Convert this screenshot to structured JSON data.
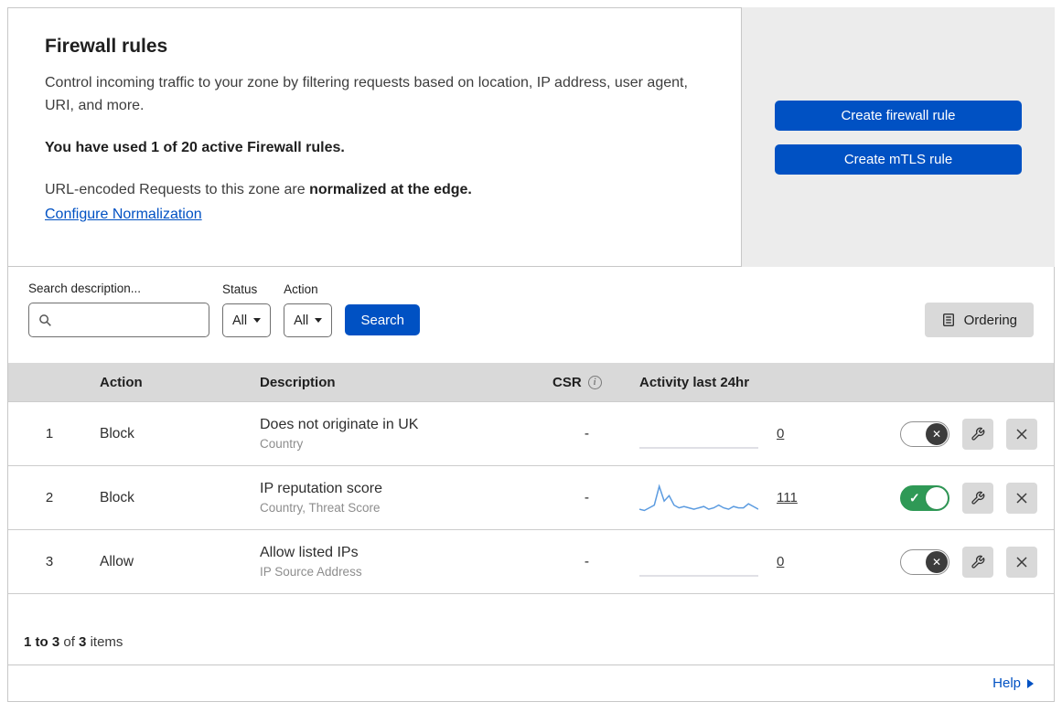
{
  "colors": {
    "primary_blue": "#0051c3",
    "toggle_on_green": "#2f9956",
    "panel_gray": "#ececec",
    "table_header_gray": "#d9d9d9",
    "sparkline_blue": "#5b9be0"
  },
  "icons": {
    "check": "✓",
    "close": "✕",
    "info": "i"
  },
  "header": {
    "title": "Firewall rules",
    "description": "Control incoming traffic to your zone by filtering requests based on location, IP address, user agent, URI, and more.",
    "usage_note": "You have used 1 of 20 active Firewall rules.",
    "normalization_text": "URL-encoded Requests to this zone are",
    "normalization_bold": "normalized at the edge.",
    "normalization_link": "Configure Normalization",
    "create_firewall_button": "Create firewall rule",
    "create_mtls_button": "Create mTLS rule"
  },
  "toolbar": {
    "search_label": "Search description...",
    "status_label": "Status",
    "status_value": "All",
    "action_label": "Action",
    "action_value": "All",
    "search_button": "Search",
    "ordering_button": "Ordering"
  },
  "table": {
    "headers": {
      "action": "Action",
      "description": "Description",
      "csr": "CSR",
      "activity": "Activity last 24hr"
    },
    "rows": [
      {
        "index": "1",
        "action": "Block",
        "description": "Does not originate in UK",
        "criteria": "Country",
        "csr": "-",
        "activity_count": "0",
        "enabled": false,
        "sparkline": [
          0,
          0,
          0,
          0,
          0,
          0,
          0,
          0,
          0,
          0,
          0,
          0,
          0,
          0,
          0,
          0,
          0,
          0,
          0,
          0,
          0,
          0,
          0,
          0,
          0
        ]
      },
      {
        "index": "2",
        "action": "Block",
        "description": "IP reputation score",
        "criteria": "Country, Threat Score",
        "csr": "-",
        "activity_count": "111",
        "enabled": true,
        "sparkline": [
          2,
          1,
          3,
          5,
          19,
          8,
          12,
          5,
          3,
          4,
          3,
          2,
          3,
          4,
          2,
          3,
          5,
          3,
          2,
          4,
          3,
          3,
          6,
          4,
          2
        ]
      },
      {
        "index": "3",
        "action": "Allow",
        "description": "Allow listed IPs",
        "criteria": "IP Source Address",
        "csr": "-",
        "activity_count": "0",
        "enabled": false,
        "sparkline": [
          0,
          0,
          0,
          0,
          0,
          0,
          0,
          0,
          0,
          0,
          0,
          0,
          0,
          0,
          0,
          0,
          0,
          0,
          0,
          0,
          0,
          0,
          0,
          0,
          0
        ]
      }
    ],
    "footer_range": "1 to 3",
    "footer_of": "of",
    "footer_total": "3",
    "footer_items": "items"
  },
  "help_link": "Help"
}
